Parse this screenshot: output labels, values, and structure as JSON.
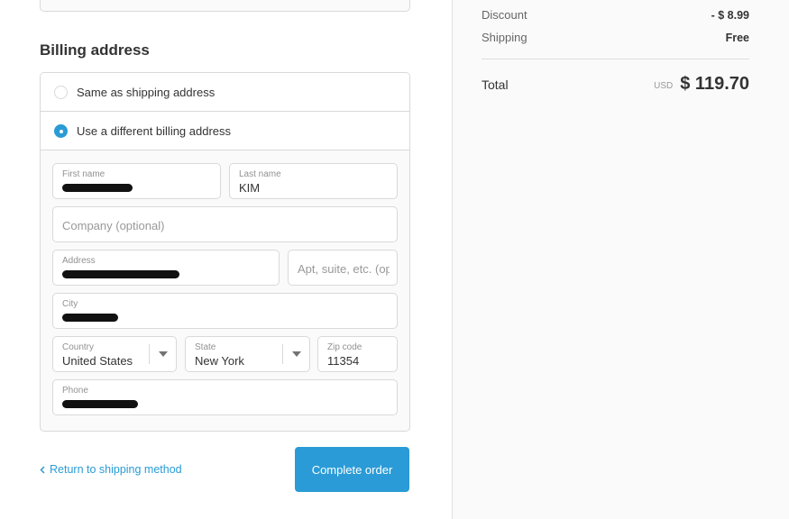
{
  "billing": {
    "title": "Billing address",
    "options": [
      {
        "label": "Same as shipping address",
        "checked": false
      },
      {
        "label": "Use a different billing address",
        "checked": true
      }
    ],
    "fields": {
      "first_name": {
        "label": "First name",
        "value": ""
      },
      "last_name": {
        "label": "Last name",
        "value": "KIM"
      },
      "company": {
        "placeholder": "Company (optional)"
      },
      "address": {
        "label": "Address",
        "value": ""
      },
      "apt": {
        "placeholder": "Apt, suite, etc. (optional)"
      },
      "city": {
        "label": "City",
        "value": ""
      },
      "country": {
        "label": "Country",
        "value": "United States"
      },
      "state": {
        "label": "State",
        "value": "New York"
      },
      "zip": {
        "label": "Zip code",
        "value": "11354"
      },
      "phone": {
        "label": "Phone",
        "value": ""
      }
    }
  },
  "actions": {
    "return_label": "Return to shipping method",
    "complete_label": "Complete order"
  },
  "summary": {
    "discount_label": "Discount",
    "discount_value": "- $ 8.99",
    "shipping_label": "Shipping",
    "shipping_value": "Free",
    "total_label": "Total",
    "currency": "USD",
    "total_value": "$ 119.70"
  },
  "colors": {
    "accent": "#2a9bd6",
    "border": "#d9d9d9",
    "sidebar_bg": "#fafafa"
  }
}
